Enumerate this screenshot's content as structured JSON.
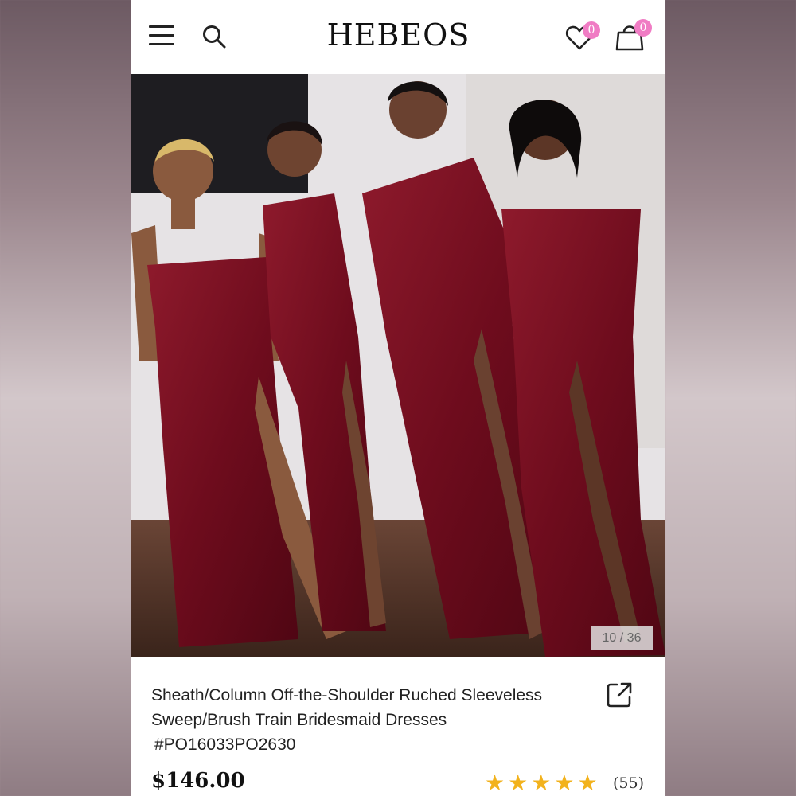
{
  "header": {
    "brand": "HEBEOS",
    "wishlist_count": "0",
    "cart_count": "0",
    "icons": [
      "menu-icon",
      "search-icon",
      "heart-icon",
      "shopping-bag-icon"
    ]
  },
  "gallery": {
    "counter": "10 / 36"
  },
  "product": {
    "title_line1": "Sheath/Column Off-the-Shoulder Ruched Sleeveless",
    "title_line2": "Sweep/Brush Train Bridesmaid Dresses",
    "sku": "#PO16033PO2630",
    "price": "$146.00",
    "rating_stars": 5,
    "review_count": "(55)"
  },
  "colors": {
    "badge": "#f07cc4",
    "star": "#f2b21c",
    "dress": "#7a0f22"
  }
}
